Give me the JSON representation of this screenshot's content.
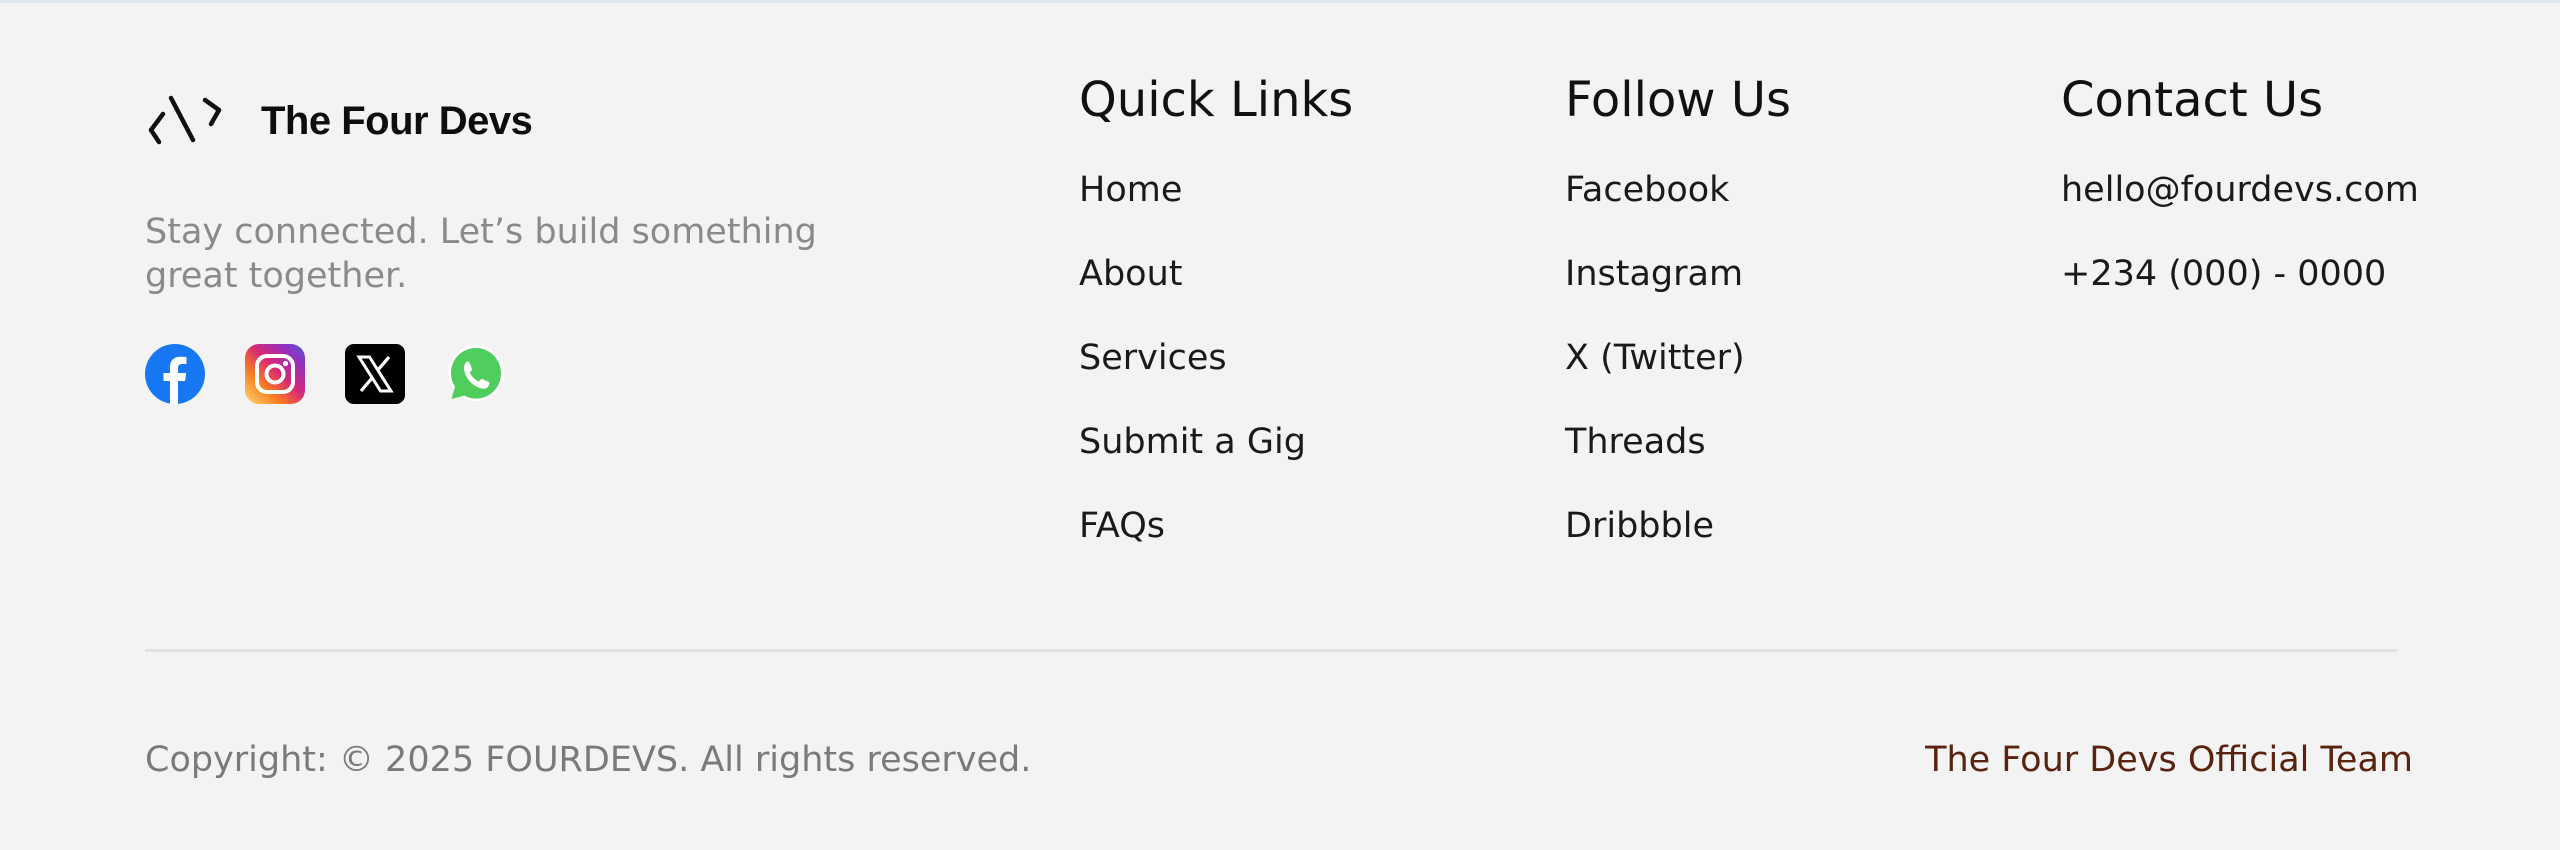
{
  "brand": {
    "name": "The Four Devs",
    "tagline": "Stay connected. Let’s build something great together."
  },
  "socials": [
    {
      "icon": "facebook-icon",
      "label": "Facebook",
      "color": "#1877F2"
    },
    {
      "icon": "instagram-icon",
      "label": "Instagram",
      "color": "#E1306C"
    },
    {
      "icon": "x-icon",
      "label": "X",
      "color": "#000000"
    },
    {
      "icon": "whatsapp-icon",
      "label": "WhatsApp",
      "color": "#25D366"
    }
  ],
  "quick_links": {
    "title": "Quick Links",
    "items": [
      "Home",
      "About",
      "Services",
      "Submit a Gig",
      "FAQs"
    ]
  },
  "follow_us": {
    "title": "Follow Us",
    "items": [
      "Facebook",
      "Instagram",
      "X (Twitter)",
      "Threads",
      "Dribbble"
    ]
  },
  "contact_us": {
    "title": "Contact Us",
    "email": "hello@fourdevs.com",
    "phone": "+234 (000) - 0000"
  },
  "bottom": {
    "copyright": "Copyright: © 2025 FOURDEVS. All rights reserved.",
    "team": "The Four Devs Official Team"
  },
  "colors": {
    "background": "#f3f3f3",
    "tagline": "#8a8a8a",
    "team_link": "#5a2310"
  }
}
